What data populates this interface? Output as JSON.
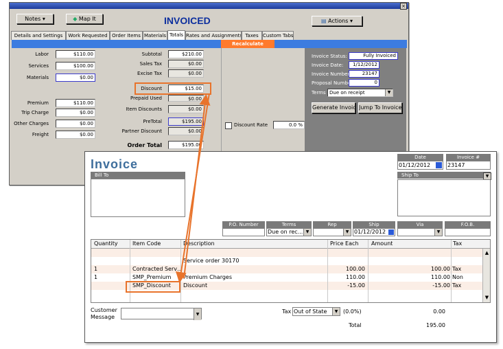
{
  "back_window": {
    "close_glyph": "×",
    "notes_label": "Notes",
    "map_it_label": "Map It",
    "status_title": "INVOICED",
    "actions_label": "Actions",
    "tabs": [
      "Details and Settings",
      "Work Requested",
      "Order Items",
      "Materials",
      "Totals",
      "Rates and Assignments",
      "Taxes",
      "Custom Tabs"
    ],
    "active_tab": "Totals",
    "recalculate_label": "Recalculate",
    "left_fields": [
      {
        "label": "Labor",
        "value": "$110.00"
      },
      {
        "label": "Services",
        "value": "$100.00"
      },
      {
        "label": "Materials",
        "value": "$0.00"
      },
      {
        "label": "Premium",
        "value": "$110.00"
      },
      {
        "label": "Trip Charge",
        "value": "$0.00"
      },
      {
        "label": "Other Charges",
        "value": "$0.00"
      },
      {
        "label": "Freight",
        "value": "$0.00"
      }
    ],
    "mid_fields": [
      {
        "label": "Subtotal",
        "value": "$210.00"
      },
      {
        "label": "Sales Tax",
        "value": "$0.00"
      },
      {
        "label": "Excise Tax",
        "value": "$0.00"
      },
      {
        "label": "Discount",
        "value": "$15.00"
      },
      {
        "label": "Prepaid Used",
        "value": "$0.00"
      },
      {
        "label": "Item Discounts",
        "value": "$0.00"
      },
      {
        "label": "PreTotal",
        "value": "$195.00"
      },
      {
        "label": "Partner Discount",
        "value": "$0.00"
      },
      {
        "label": "Order Total",
        "value": "$195.00"
      }
    ],
    "discount_rate_label": "Discount Rate",
    "discount_rate_value": "0.0 %",
    "status_panel": {
      "invoice_status_label": "Invoice Status:",
      "invoice_status": "Fully Invoiced",
      "invoice_date_label": "Invoice Date:",
      "invoice_date": "1/12/2012",
      "invoice_number_label": "Invoice Number:",
      "invoice_number": "23147",
      "proposal_number_label": "Proposal Number:",
      "proposal_number": "0",
      "terms_label": "Terms",
      "terms_value": "Due on receipt",
      "generate_invoice_label": "Generate Invoice",
      "jump_to_invoice_label": "Jump To Invoice"
    }
  },
  "invoice_window": {
    "title": "Invoice",
    "date_header": "Date",
    "date_value": "01/12/2012",
    "invoice_no_header": "Invoice #",
    "invoice_no_value": "23147",
    "bill_to_label": "Bill To",
    "ship_to_label": "Ship To",
    "po_header": "P.O. Number",
    "terms_header": "Terms",
    "terms_value": "Due on rec...",
    "rep_header": "Rep",
    "ship_header": "Ship",
    "ship_value": "01/12/2012",
    "via_header": "Via",
    "fob_header": "F.O.B.",
    "columns": [
      "Quantity",
      "Item Code",
      "Description",
      "Price Each",
      "Amount",
      "Tax"
    ],
    "rows": [
      {
        "qty": "",
        "code": "",
        "desc": "",
        "price": "",
        "amount": "",
        "tax": ""
      },
      {
        "qty": "",
        "code": "",
        "desc": "Service order 30170",
        "price": "",
        "amount": "",
        "tax": ""
      },
      {
        "qty": "1",
        "code": "Contracted Serv…",
        "desc": "",
        "price": "100.00",
        "amount": "100.00",
        "tax": "Tax"
      },
      {
        "qty": "1",
        "code": "SMP_Premium",
        "desc": "Premium Charges",
        "price": "110.00",
        "amount": "110.00",
        "tax": "Non"
      },
      {
        "qty": "",
        "code": "SMP_Discount",
        "desc": "Discount",
        "price": "-15.00",
        "amount": "-15.00",
        "tax": "Tax"
      },
      {
        "qty": "",
        "code": "",
        "desc": "",
        "price": "",
        "amount": "",
        "tax": ""
      }
    ],
    "customer_message_label": "Customer Message",
    "tax_label": "Tax",
    "tax_value": "Out of State",
    "tax_rate": "(0.0%)",
    "tax_amount": "0.00",
    "total_label": "Total",
    "total_value": "195.00"
  },
  "colors": {
    "accent_orange": "#e8732b",
    "title_blue": "#0d2f9e",
    "bar_blue": "#3c7ce0",
    "invoice_title": "#3e6e9c"
  }
}
